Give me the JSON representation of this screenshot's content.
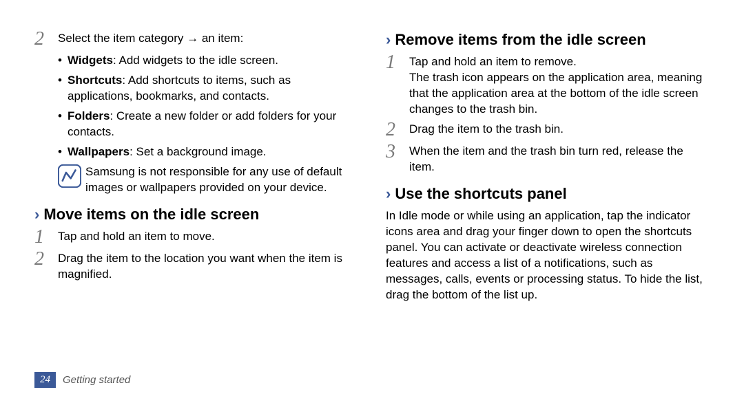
{
  "left": {
    "step2_intro": "Select the item category → an item:",
    "bullets": {
      "widgets_label": "Widgets",
      "widgets_text": ": Add widgets to the idle screen.",
      "shortcuts_label": "Shortcuts",
      "shortcuts_text": ": Add shortcuts to items, such as applications, bookmarks, and contacts.",
      "folders_label": "Folders",
      "folders_text": ": Create a new folder or add folders for your contacts.",
      "wallpapers_label": "Wallpapers",
      "wallpapers_text": ": Set a background image."
    },
    "note": "Samsung is not responsible for any use of default images or wallpapers provided on your device.",
    "move_heading": "Move items on the idle screen",
    "move_step1": "Tap and hold an item to move.",
    "move_step2": "Drag the item to the location you want when the item is magnified."
  },
  "right": {
    "remove_heading": "Remove items from the idle screen",
    "remove_step1a": "Tap and hold an item to remove.",
    "remove_step1b": "The trash icon appears on the application area, meaning that the application area at the bottom of the idle screen changes to the trash bin.",
    "remove_step2": "Drag the item to the trash bin.",
    "remove_step3": "When the item and the trash bin turn red, release the item.",
    "shortcuts_heading": "Use the shortcuts panel",
    "shortcuts_para": "In Idle mode or while using an application, tap the indicator icons area and drag your finger down to open the shortcuts panel. You can activate or deactivate wireless connection features and access a list of a notifications, such as messages, calls, events or processing status. To hide the list, drag the bottom of the list up."
  },
  "numbers": {
    "n1": "1",
    "n2": "2",
    "n3": "3"
  },
  "chevron": "›",
  "footer": {
    "page": "24",
    "section": "Getting started"
  }
}
